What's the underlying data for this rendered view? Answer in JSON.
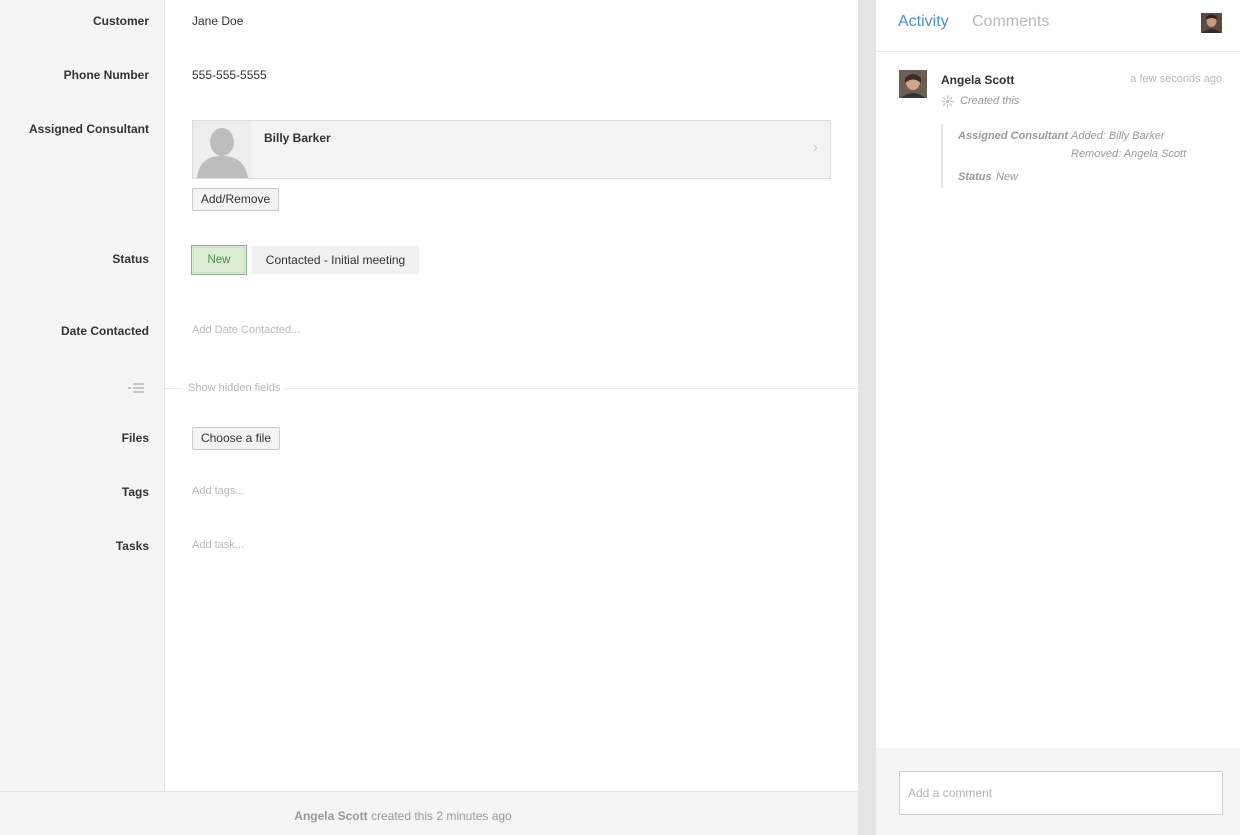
{
  "record": {
    "fields": {
      "customer": {
        "label": "Customer",
        "value": "Jane Doe"
      },
      "phone": {
        "label": "Phone Number",
        "value": "555-555-5555"
      },
      "consultant": {
        "label": "Assigned Consultant",
        "name": "Billy Barker",
        "button": "Add/Remove"
      },
      "status": {
        "label": "Status",
        "options": [
          "New",
          "Contacted - Initial meeting"
        ],
        "selected": "New"
      },
      "date_contacted": {
        "label": "Date Contacted",
        "placeholder": "Add Date Contacted..."
      },
      "hidden_fields_toggle": "Show hidden fields",
      "files": {
        "label": "Files",
        "button": "Choose a file"
      },
      "tags": {
        "label": "Tags",
        "placeholder": "Add tags..."
      },
      "tasks": {
        "label": "Tasks",
        "placeholder": "Add task..."
      }
    },
    "footer": {
      "author": "Angela Scott",
      "text": "created this 2 minutes ago"
    }
  },
  "activity": {
    "tabs": [
      "Activity",
      "Comments"
    ],
    "active_tab": "Activity",
    "entry": {
      "author": "Angela Scott",
      "time": "a few seconds ago",
      "action": "Created this",
      "changes": {
        "consultant_label": "Assigned Consultant",
        "added": "Added: Billy Barker",
        "removed": "Removed: Angela Scott",
        "status_label": "Status",
        "status_value": "New"
      }
    },
    "comment_placeholder": "Add a comment"
  },
  "colors": {
    "accent": "#4a90c8",
    "status_new_bg": "#dcedd6",
    "status_new_text": "#4a8a45",
    "panel_bg": "#f5f5f5"
  }
}
